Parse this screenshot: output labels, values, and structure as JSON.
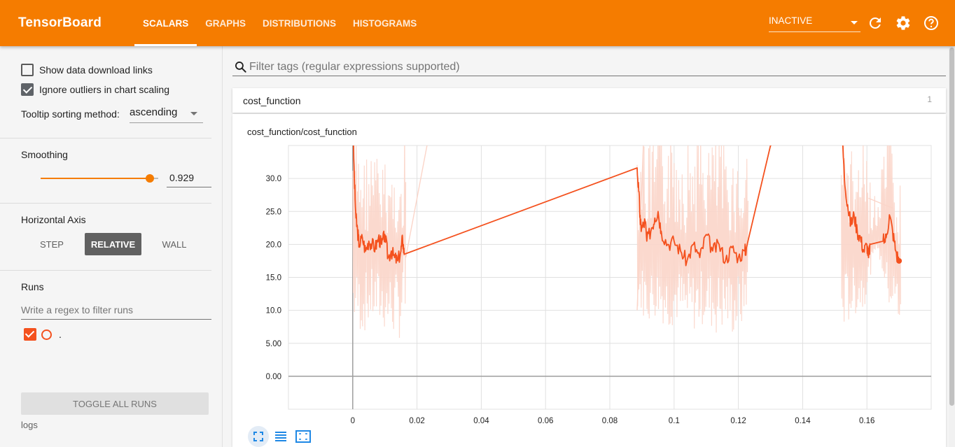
{
  "header": {
    "brand": "TensorBoard",
    "tabs": [
      {
        "label": "SCALARS",
        "active": true
      },
      {
        "label": "GRAPHS",
        "active": false
      },
      {
        "label": "DISTRIBUTIONS",
        "active": false
      },
      {
        "label": "HISTOGRAMS",
        "active": false
      }
    ],
    "status_select": "INACTIVE",
    "icons": [
      "refresh-icon",
      "gear-icon",
      "help-icon"
    ],
    "color": "#f57c00"
  },
  "sidebar": {
    "show_download_links": {
      "label": "Show data download links",
      "checked": false
    },
    "ignore_outliers": {
      "label": "Ignore outliers in chart scaling",
      "checked": true
    },
    "tooltip_sorting": {
      "label": "Tooltip sorting method:",
      "value": "ascending"
    },
    "smoothing": {
      "label": "Smoothing",
      "value": "0.929",
      "level": 0.929
    },
    "horizontal_axis": {
      "label": "Horizontal Axis",
      "options": [
        "STEP",
        "RELATIVE",
        "WALL"
      ],
      "selected": "RELATIVE"
    },
    "runs": {
      "label": "Runs",
      "filter_placeholder": "Write a regex to filter runs",
      "items": [
        {
          "name": ".",
          "checked": true,
          "color": "#f4511e"
        }
      ]
    },
    "toggle_all": "TOGGLE ALL RUNS",
    "logdir": "logs"
  },
  "main": {
    "search_placeholder": "Filter tags (regular expressions supported)",
    "category": {
      "name": "cost_function",
      "count": "1"
    },
    "chart_title": "cost_function/cost_function"
  },
  "chart_data": {
    "type": "line",
    "title": "cost_function/cost_function",
    "x_ticks": [
      "0",
      "0.02",
      "0.04",
      "0.06",
      "0.08",
      "0.1",
      "0.12",
      "0.14",
      "0.16"
    ],
    "y_ticks": [
      "0.00",
      "5.00",
      "10.0",
      "15.0",
      "20.0",
      "25.0",
      "30.0"
    ],
    "xlim": [
      -0.02,
      0.18
    ],
    "ylim": [
      -5,
      35
    ],
    "grid": true,
    "series": [
      {
        "name": ".",
        "color": "#f4511e",
        "smoothed": [
          [
            0,
            40
          ],
          [
            0.0005,
            30
          ],
          [
            0.001,
            24
          ],
          [
            0.0015,
            22
          ],
          [
            0.002,
            20
          ],
          [
            0.003,
            21
          ],
          [
            0.004,
            19
          ],
          [
            0.005,
            20.5
          ],
          [
            0.006,
            20
          ],
          [
            0.007,
            19.5
          ],
          [
            0.008,
            21
          ],
          [
            0.009,
            20
          ],
          [
            0.01,
            21.5
          ],
          [
            0.011,
            18
          ],
          [
            0.012,
            19
          ],
          [
            0.013,
            18
          ],
          [
            0.014,
            17.5
          ],
          [
            0.015,
            19
          ],
          [
            0.0155,
            21
          ],
          [
            0.016,
            18.5
          ],
          [
            0.0885,
            31.6
          ],
          [
            0.089,
            28
          ],
          [
            0.0895,
            23
          ],
          [
            0.09,
            22.5
          ],
          [
            0.091,
            23.5
          ],
          [
            0.0915,
            20.5
          ],
          [
            0.093,
            22.5
          ],
          [
            0.094,
            24
          ],
          [
            0.095,
            25
          ],
          [
            0.096,
            22
          ],
          [
            0.098,
            20
          ],
          [
            0.1,
            20.5
          ],
          [
            0.102,
            19
          ],
          [
            0.104,
            17.5
          ],
          [
            0.106,
            20
          ],
          [
            0.108,
            18
          ],
          [
            0.11,
            21.5
          ],
          [
            0.112,
            19
          ],
          [
            0.114,
            20
          ],
          [
            0.116,
            17.5
          ],
          [
            0.118,
            19.5
          ],
          [
            0.12,
            18
          ],
          [
            0.122,
            19
          ],
          [
            0.1225,
            19.5
          ],
          [
            0.13,
            35
          ],
          [
            0.152,
            40
          ],
          [
            0.153,
            30
          ],
          [
            0.154,
            26
          ],
          [
            0.155,
            23
          ],
          [
            0.156,
            24.5
          ],
          [
            0.157,
            22
          ],
          [
            0.158,
            21
          ],
          [
            0.159,
            19
          ],
          [
            0.16,
            20
          ],
          [
            0.1605,
            18
          ],
          [
            0.161,
            20
          ],
          [
            0.165,
            20.5
          ],
          [
            0.166,
            21
          ],
          [
            0.167,
            24.5
          ],
          [
            0.168,
            22
          ],
          [
            0.169,
            19
          ],
          [
            0.17,
            17.5
          ]
        ],
        "raw_max_pairs": [
          [
            0,
            40,
            8
          ],
          [
            0.003,
            34,
            6
          ],
          [
            0.006,
            35,
            8
          ],
          [
            0.009,
            33,
            7
          ],
          [
            0.012,
            32,
            6
          ],
          [
            0.015,
            30,
            5.5
          ],
          [
            0.016,
            22,
            15
          ],
          [
            0.089,
            40,
            10
          ],
          [
            0.092,
            35,
            8
          ],
          [
            0.095,
            38,
            9
          ],
          [
            0.098,
            40,
            7
          ],
          [
            0.101,
            38,
            8
          ],
          [
            0.104,
            36,
            6
          ],
          [
            0.107,
            38,
            7
          ],
          [
            0.11,
            36,
            8
          ],
          [
            0.113,
            38,
            6
          ],
          [
            0.116,
            35,
            7
          ],
          [
            0.119,
            34,
            5.5
          ],
          [
            0.122,
            30,
            8
          ],
          [
            0.153,
            40,
            7
          ],
          [
            0.156,
            33,
            9
          ],
          [
            0.159,
            36,
            10
          ],
          [
            0.163,
            26,
            20
          ],
          [
            0.167,
            40,
            10
          ],
          [
            0.169,
            28,
            8
          ],
          [
            0.17,
            20,
            7
          ]
        ],
        "last_point": [
          0.17,
          17.5
        ]
      }
    ]
  }
}
